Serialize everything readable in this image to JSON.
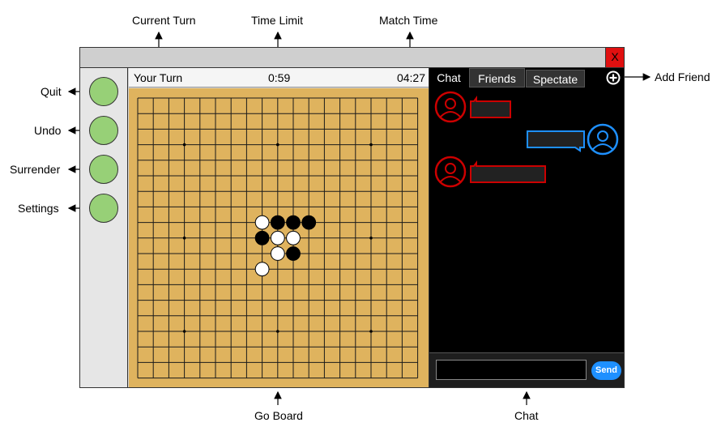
{
  "annotations": {
    "current_turn": "Current Turn",
    "time_limit": "Time Limit",
    "match_time": "Match Time",
    "quit": "Quit",
    "undo": "Undo",
    "surrender": "Surrender",
    "settings": "Settings",
    "add_friend": "Add Friend",
    "go_board": "Go Board",
    "chat": "Chat"
  },
  "window": {
    "close_label": "X"
  },
  "status": {
    "turn": "Your Turn",
    "time_limit": "0:59",
    "match_time": "04:27"
  },
  "tabs": [
    {
      "label": "Chat",
      "active": true
    },
    {
      "label": "Friends",
      "active": false
    },
    {
      "label": "Spectate",
      "active": false
    }
  ],
  "chat": {
    "send_label": "Send",
    "input_value": ""
  },
  "colors": {
    "board": "#dfb35e",
    "button": "#97d077",
    "opponent": "#cc0000",
    "self": "#1e90ff",
    "close": "#e01010"
  },
  "icons": {
    "add_friend": "plus-circle-icon",
    "avatar": "user-icon"
  },
  "board": {
    "size": 19,
    "hoshi": [
      [
        3,
        3
      ],
      [
        3,
        9
      ],
      [
        3,
        15
      ],
      [
        9,
        3
      ],
      [
        9,
        9
      ],
      [
        9,
        15
      ],
      [
        15,
        3
      ],
      [
        15,
        9
      ],
      [
        15,
        15
      ]
    ],
    "stones": [
      {
        "col": 8,
        "row": 8,
        "color": "white"
      },
      {
        "col": 9,
        "row": 8,
        "color": "black"
      },
      {
        "col": 10,
        "row": 8,
        "color": "black"
      },
      {
        "col": 11,
        "row": 8,
        "color": "black"
      },
      {
        "col": 8,
        "row": 9,
        "color": "black"
      },
      {
        "col": 9,
        "row": 9,
        "color": "white"
      },
      {
        "col": 10,
        "row": 9,
        "color": "white"
      },
      {
        "col": 9,
        "row": 10,
        "color": "white"
      },
      {
        "col": 10,
        "row": 10,
        "color": "black"
      },
      {
        "col": 8,
        "row": 11,
        "color": "white"
      }
    ]
  }
}
